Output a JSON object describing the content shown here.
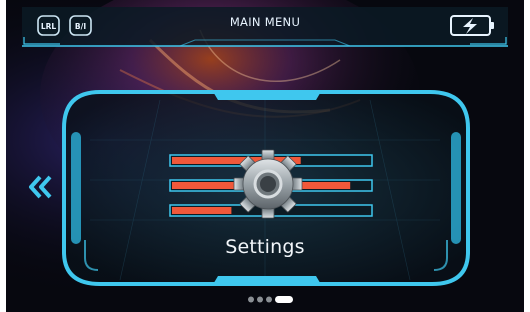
{
  "header": {
    "title": "MAIN MENU",
    "badge_left_1": "LRL",
    "badge_left_2": "B/I",
    "battery_icon": "battery-charging-icon"
  },
  "menu": {
    "current_item": "Settings",
    "icon": "gear-icon",
    "nav_left_icon": "double-chevron-left-icon",
    "page_count": 4,
    "active_page": 4,
    "slider_levels": [
      0.65,
      0.9,
      0.3
    ]
  },
  "colors": {
    "accent_cyan": "#3fc7ee",
    "slider_orange": "#f0583a",
    "text": "#f2f6fa"
  }
}
